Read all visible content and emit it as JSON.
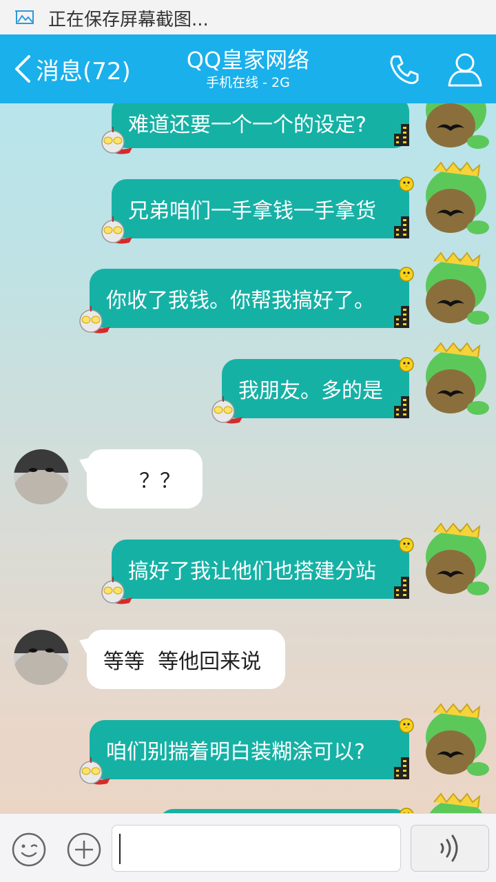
{
  "statusbar": {
    "notification_text": "正在保存屏幕截图...",
    "icon": "screenshot-icon"
  },
  "header": {
    "back_label": "消息(72)",
    "title": "QQ皇家网络",
    "subtitle": "手机在线 - 2G",
    "phone_icon": "phone-icon",
    "profile_icon": "profile-icon"
  },
  "colors": {
    "header_bg": "#1ab0ec",
    "outgoing_bubble": "#16b1a5",
    "incoming_bubble": "#ffffff"
  },
  "messages": [
    {
      "direction": "out",
      "text": "难道还要一个一个的设定?"
    },
    {
      "direction": "out",
      "text": "兄弟咱们一手拿钱一手拿货"
    },
    {
      "direction": "out",
      "text": "你收了我钱。你帮我搞好了。"
    },
    {
      "direction": "out",
      "text": "我朋友。多的是"
    },
    {
      "direction": "in",
      "text": "？？"
    },
    {
      "direction": "out",
      "text": "搞好了我让他们也搭建分站"
    },
    {
      "direction": "in",
      "text": "等等  等他回来说"
    },
    {
      "direction": "out",
      "text": "咱们别揣着明白装糊涂可以?"
    }
  ],
  "input_bar": {
    "emoji_icon": "emoji-icon",
    "plus_icon": "plus-icon",
    "voice_icon": "voice-icon",
    "text_value": ""
  }
}
